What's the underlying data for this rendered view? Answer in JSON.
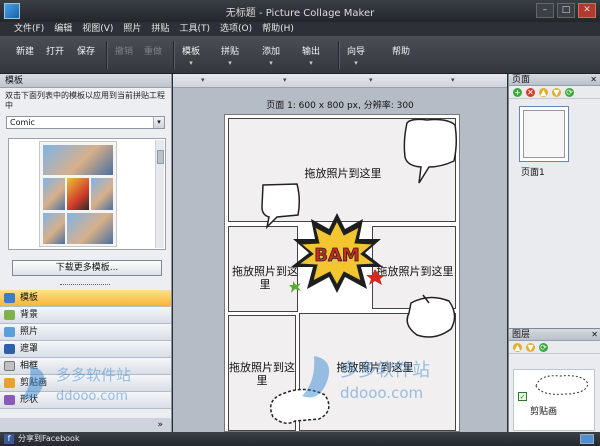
{
  "window": {
    "title": "无标题 - Picture Collage Maker"
  },
  "menu": [
    "文件(F)",
    "编辑",
    "视图(V)",
    "照片",
    "拼贴",
    "工具(T)",
    "选项(O)",
    "帮助(H)"
  ],
  "toolbar": {
    "new": "新建",
    "open": "打开",
    "save": "保存",
    "undo": "撤销",
    "redo": "重做",
    "template": "模板",
    "collage": "拼贴",
    "add": "添加",
    "output": "输出",
    "wizard": "向导",
    "help": "帮助"
  },
  "left": {
    "header": "模板",
    "instruction": "双击下面列表中的模板以应用到当前拼贴工程中",
    "combo_value": "Comic",
    "more_button": "下载更多模板...",
    "categories": [
      "模板",
      "背景",
      "照片",
      "遮罩",
      "相框",
      "剪贴画",
      "形状"
    ],
    "footer": "»"
  },
  "canvas": {
    "page_info": "页面 1: 600 x 800 px, 分辨率: 300",
    "drop_text_1": "拖放照片到这里",
    "drop_text_2": "拖放照片到这里",
    "drop_text_3": "拖放照片到这里",
    "drop_text_4": "拖放照片到这里",
    "drop_text_5": "拖放照片到这里",
    "bam_text": "BAM"
  },
  "right": {
    "pages_header": "页面",
    "page_label": "页面1",
    "layers_header": "图层",
    "layer_label": "剪贴画"
  },
  "status": {
    "share": "分享到Facebook"
  },
  "watermark": {
    "text": "多多软件站",
    "url": "ddooo.com"
  }
}
